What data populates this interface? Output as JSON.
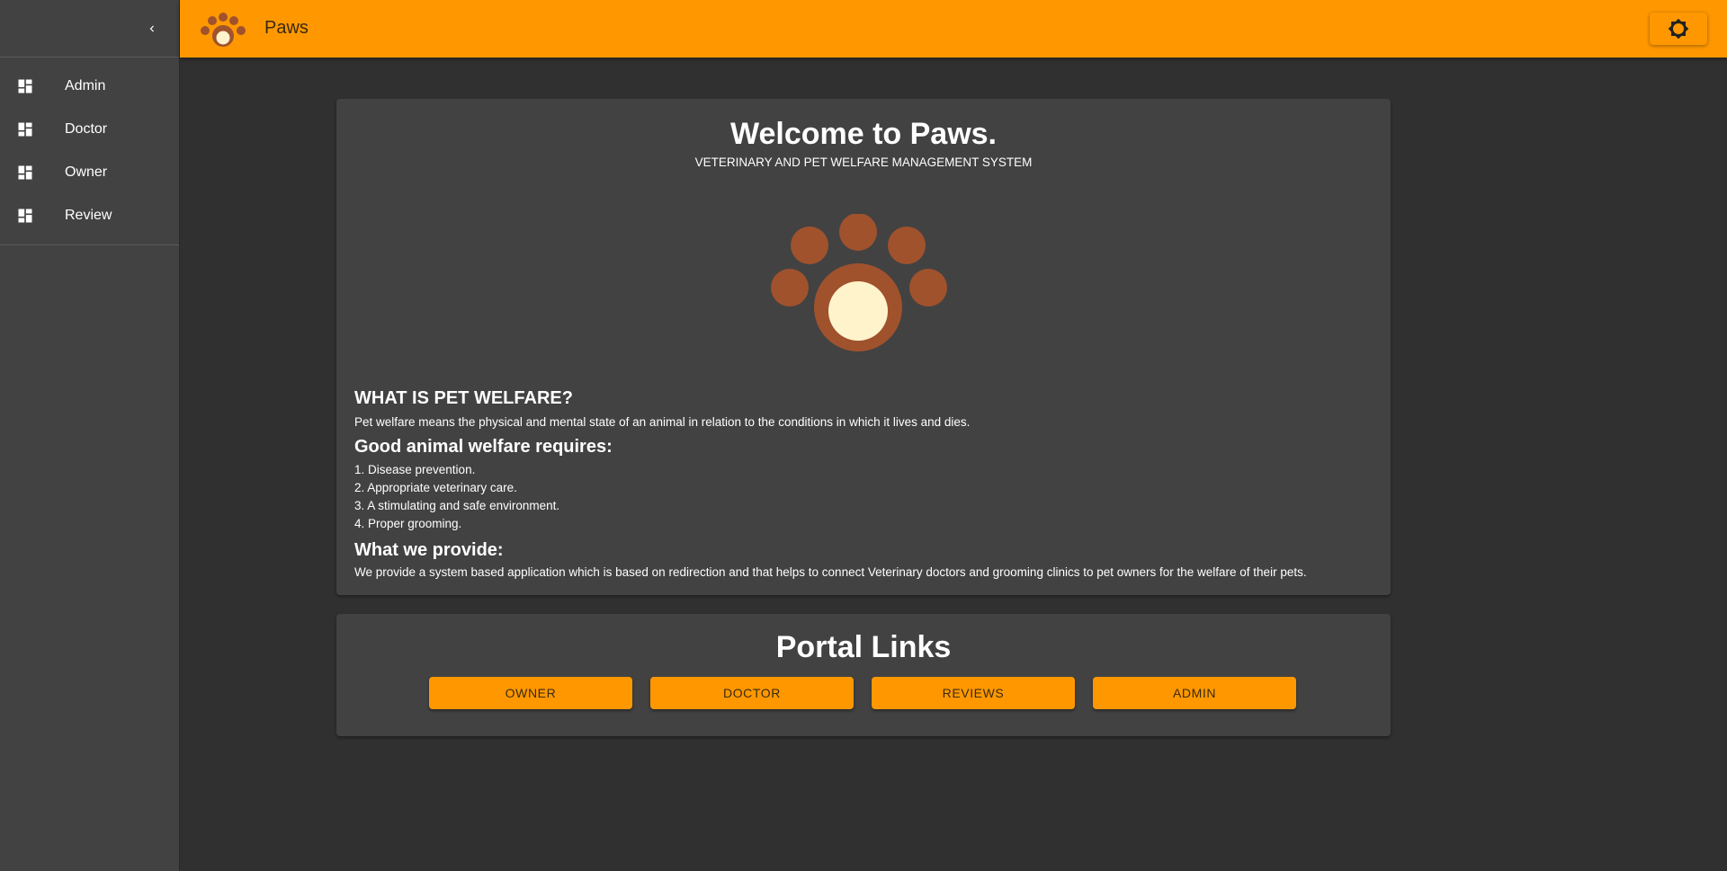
{
  "app": {
    "title": "Paws"
  },
  "colors": {
    "accent": "#ff9800",
    "background": "#303030",
    "surface": "#424242",
    "paw_brown": "#a0522d",
    "paw_center": "#fff3cc"
  },
  "sidebar": {
    "collapse_icon": "chevron-left-icon",
    "items": [
      {
        "label": "Admin",
        "icon": "dashboard-icon"
      },
      {
        "label": "Doctor",
        "icon": "dashboard-icon"
      },
      {
        "label": "Owner",
        "icon": "dashboard-icon"
      },
      {
        "label": "Review",
        "icon": "dashboard-icon"
      }
    ]
  },
  "toolbar": {
    "settings_icon": "brightness-icon"
  },
  "welcome": {
    "title": "Welcome to Paws.",
    "subtitle": "VETERINARY AND PET WELFARE MANAGEMENT SYSTEM",
    "what_is_heading": "WHAT IS PET WELFARE?",
    "what_is_text": "Pet welfare means the physical and mental state of an animal in relation to the conditions in which it lives and dies.",
    "requires_heading": "Good animal welfare requires:",
    "requires_list": [
      "1. Disease prevention.",
      "2. Appropriate veterinary care.",
      "3. A stimulating and safe environment.",
      "4. Proper grooming."
    ],
    "provide_heading": "What we provide:",
    "provide_text": "We provide a system based application which is based on redirection and that helps to connect Veterinary doctors and grooming clinics to pet owners for the welfare of their pets."
  },
  "portal": {
    "title": "Portal Links",
    "buttons": [
      {
        "label": "OWNER"
      },
      {
        "label": "DOCTOR"
      },
      {
        "label": "REVIEWS"
      },
      {
        "label": "ADMIN"
      }
    ]
  }
}
